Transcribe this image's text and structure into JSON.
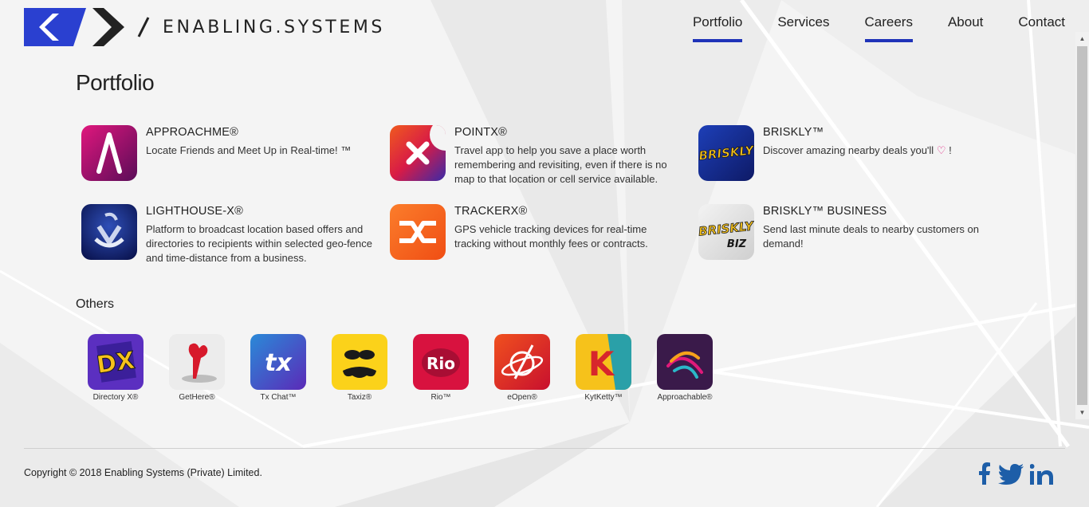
{
  "brand": {
    "name": "ENABLING.SYSTEMS",
    "accent": "#1f33b8",
    "logo_blue": "#2a40d0",
    "logo_dark": "#222222"
  },
  "nav": [
    {
      "label": "Portfolio",
      "active": true
    },
    {
      "label": "Services",
      "active": false
    },
    {
      "label": "Careers",
      "active": true
    },
    {
      "label": "About",
      "active": false
    },
    {
      "label": "Contact",
      "active": false
    }
  ],
  "page_title": "Portfolio",
  "apps": [
    {
      "name": "APPROACHME®",
      "desc": "Locate Friends and Meet Up in Real-time! ™",
      "icon": "approachme-icon"
    },
    {
      "name": "POINTX®",
      "desc": "Travel app to help you save a place worth remembering and revisiting, even if there is no map to that location or cell service available.",
      "icon": "pointx-icon"
    },
    {
      "name": "BRISKLY™",
      "desc": "Discover amazing nearby deals you'll",
      "desc_after": " !",
      "icon": "briskly-icon"
    },
    {
      "name": "LIGHTHOUSE-X®",
      "desc": "Platform to broadcast location based offers and directories to recipients within selected geo-fence and time-distance from a business.",
      "icon": "lighthouse-x-icon"
    },
    {
      "name": "TRACKERX®",
      "desc": "GPS vehicle tracking devices for real-time tracking without monthly fees or contracts.",
      "icon": "trackerx-icon"
    },
    {
      "name": "BRISKLY™ BUSINESS",
      "desc": "Send last minute deals to nearby customers on demand!",
      "icon": "briskly-biz-icon"
    }
  ],
  "briskly_icon_text": "BRISKLY",
  "briskly_biz_icon_text": [
    "BRISKLY",
    "BIZ"
  ],
  "others_title": "Others",
  "others": [
    {
      "label": "Directory X®",
      "icon": "directory-x-icon",
      "mark": "DX"
    },
    {
      "label": "GetHere®",
      "icon": "gethere-icon"
    },
    {
      "label": "Tx Chat™",
      "icon": "tx-chat-icon",
      "mark": "tx"
    },
    {
      "label": "Taxiz®",
      "icon": "taxiz-icon"
    },
    {
      "label": "Rio™",
      "icon": "rio-icon",
      "mark": "Rio"
    },
    {
      "label": "eOpen®",
      "icon": "eopen-icon"
    },
    {
      "label": "KytKetty™",
      "icon": "kytketty-icon",
      "mark": "K"
    },
    {
      "label": "Approachable®",
      "icon": "approachable-icon"
    }
  ],
  "copyright": "Copyright © 2018 Enabling Systems (Private) Limited.",
  "social": [
    {
      "name": "facebook-icon",
      "glyph": "f"
    },
    {
      "name": "twitter-icon"
    },
    {
      "name": "linkedin-icon",
      "glyph": "in"
    }
  ],
  "social_color": "#1d5ea8"
}
